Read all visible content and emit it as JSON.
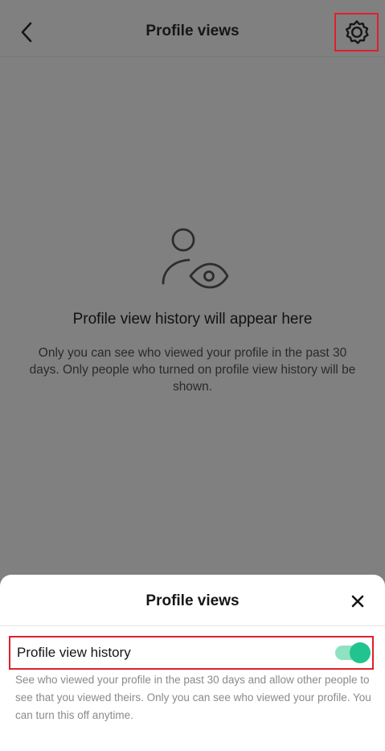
{
  "header": {
    "title": "Profile views",
    "back_icon": "chevron-left-icon",
    "settings_icon": "gear-icon"
  },
  "empty_state": {
    "icon": "person-eye-icon",
    "title": "Profile view history will appear here",
    "description": "Only you can see who viewed your profile in the past 30 days. Only people who turned on profile view history will be shown."
  },
  "sheet": {
    "title": "Profile views",
    "close_icon": "close-icon",
    "history": {
      "label": "Profile view history",
      "enabled": true,
      "description": "See who viewed your profile in the past 30 days and allow other people to see that you viewed theirs. Only you can see who viewed your profile. You can turn this off anytime."
    }
  },
  "colors": {
    "overlay": "#808080",
    "toggle_on": "#21c48e",
    "toggle_track": "#8ee2c2",
    "highlight": "#e0202c"
  }
}
